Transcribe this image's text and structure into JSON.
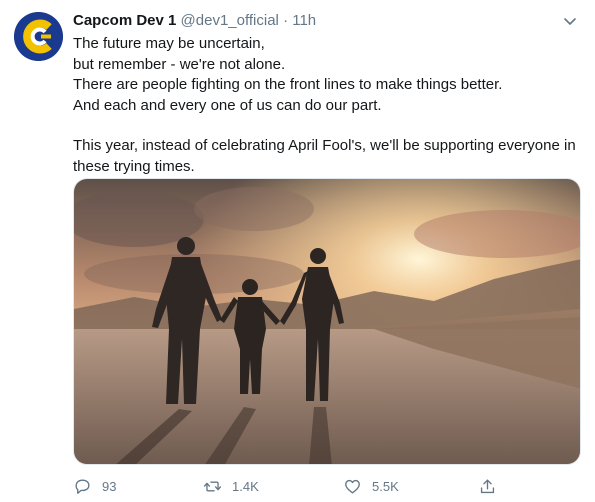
{
  "tweet": {
    "display_name": "Capcom Dev 1",
    "handle": "@dev1_official",
    "separator": "·",
    "time": "11h",
    "avatar_icon": "capcom-c-logo",
    "lines": [
      "The future may be uncertain,",
      "but remember - we're not alone.",
      "There are people fighting on the front lines to make things better.",
      "And each and every one of us can do our part."
    ],
    "paragraph2": "This year, instead of celebrating April Fool's, we'll be supporting everyone in these trying times.",
    "media_description_icon": "family-walking-sunset-image"
  },
  "actions": {
    "reply_count": "93",
    "retweet_count": "1.4K",
    "like_count": "5.5K",
    "share_label": ""
  },
  "colors": {
    "secondary_text": "#657786",
    "avatar_blue": "#1a3a8f",
    "avatar_yellow": "#f2c200"
  }
}
